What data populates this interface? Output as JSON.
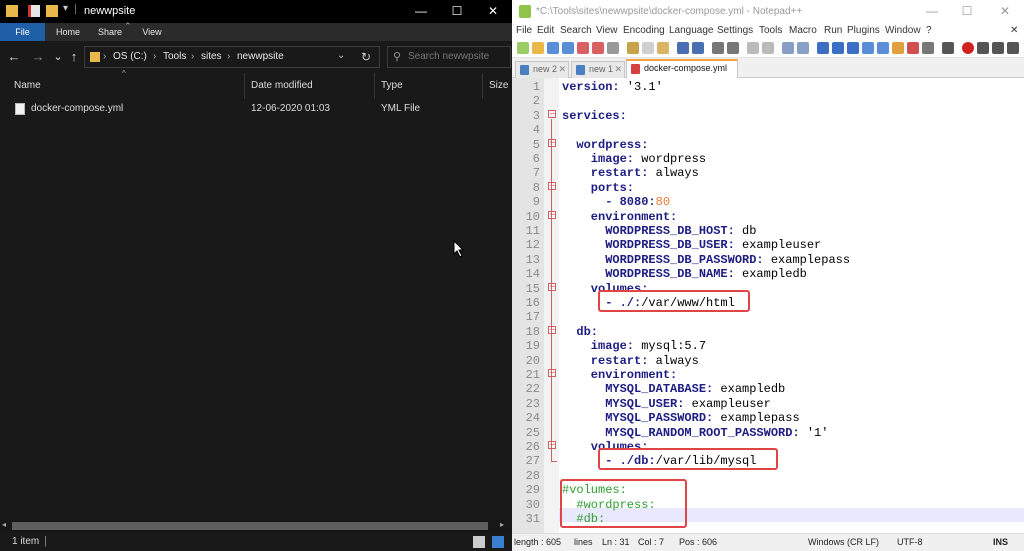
{
  "explorer": {
    "title": "newwpsite",
    "window_controls": {
      "min": "—",
      "max": "☐",
      "close": "✕"
    },
    "ribbon_tabs": [
      "File",
      "Home",
      "Share",
      "View"
    ],
    "nav": {
      "back": "←",
      "forward": "→",
      "recent": "⌄",
      "up": "↑",
      "refresh": "↻"
    },
    "breadcrumbs": [
      "OS (C:)",
      "Tools",
      "sites",
      "newwpsite"
    ],
    "search_placeholder": "Search newwpsite",
    "columns": [
      "Name",
      "Date modified",
      "Type",
      "Size"
    ],
    "files": [
      {
        "name": "docker-compose.yml",
        "date": "12-06-2020 01:03",
        "type": "YML File",
        "size": ""
      }
    ],
    "status": "1 item"
  },
  "notepad": {
    "title": "*C:\\Tools\\sites\\newwpsite\\docker-compose.yml - Notepad++",
    "window_controls": {
      "min": "—",
      "max": "☐",
      "close": "✕"
    },
    "menu": [
      "File",
      "Edit",
      "Search",
      "View",
      "Encoding",
      "Language",
      "Settings",
      "Tools",
      "Macro",
      "Run",
      "Plugins",
      "Window",
      "?"
    ],
    "tabs": [
      {
        "label": "new 2"
      },
      {
        "label": "new 1"
      },
      {
        "label": "docker-compose.yml",
        "active": true
      }
    ],
    "tab_close": "✕",
    "lines": [
      {
        "n": "1",
        "key": "version:",
        "val": " '3.1'"
      },
      {
        "n": "2",
        "key": "",
        "val": ""
      },
      {
        "n": "3",
        "key": "services:",
        "val": ""
      },
      {
        "n": "4",
        "key": "",
        "val": ""
      },
      {
        "n": "5",
        "key": "  wordpress:",
        "val": ""
      },
      {
        "n": "6",
        "key": "    image:",
        "val": " wordpress"
      },
      {
        "n": "7",
        "key": "    restart:",
        "val": " always"
      },
      {
        "n": "8",
        "key": "    ports:",
        "val": ""
      },
      {
        "n": "9",
        "key": "      - 8080:",
        "val": "80",
        "num": true
      },
      {
        "n": "10",
        "key": "    environment:",
        "val": ""
      },
      {
        "n": "11",
        "key": "      WORDPRESS_DB_HOST:",
        "val": " db"
      },
      {
        "n": "12",
        "key": "      WORDPRESS_DB_USER:",
        "val": " exampleuser"
      },
      {
        "n": "13",
        "key": "      WORDPRESS_DB_PASSWORD:",
        "val": " examplepass"
      },
      {
        "n": "14",
        "key": "      WORDPRESS_DB_NAME:",
        "val": " exampledb"
      },
      {
        "n": "15",
        "key": "    volumes:",
        "val": ""
      },
      {
        "n": "16",
        "key": "      - ./:",
        "val": "/var/www/html"
      },
      {
        "n": "17",
        "key": "",
        "val": ""
      },
      {
        "n": "18",
        "key": "  db:",
        "val": ""
      },
      {
        "n": "19",
        "key": "    image:",
        "val": " mysql:5.7"
      },
      {
        "n": "20",
        "key": "    restart:",
        "val": " always"
      },
      {
        "n": "21",
        "key": "    environment:",
        "val": ""
      },
      {
        "n": "22",
        "key": "      MYSQL_DATABASE:",
        "val": " exampledb"
      },
      {
        "n": "23",
        "key": "      MYSQL_USER:",
        "val": " exampleuser"
      },
      {
        "n": "24",
        "key": "      MYSQL_PASSWORD:",
        "val": " examplepass"
      },
      {
        "n": "25",
        "key": "      MYSQL_RANDOM_ROOT_PASSWORD:",
        "val": " '1'"
      },
      {
        "n": "26",
        "key": "    volumes:",
        "val": ""
      },
      {
        "n": "27",
        "key": "      - ./db:",
        "val": "/var/lib/mysql"
      },
      {
        "n": "28",
        "key": "",
        "val": ""
      },
      {
        "n": "29",
        "comment": "#volumes:"
      },
      {
        "n": "30",
        "comment": "  #wordpress:"
      },
      {
        "n": "31",
        "comment": "  #db:"
      }
    ],
    "status": {
      "length": "length : 605",
      "lines": "lines",
      "ln": "Ln : 31",
      "col": "Col : 7",
      "pos": "Pos : 606",
      "eol": "Windows (CR LF)",
      "encoding": "UTF-8",
      "mode": "INS"
    }
  },
  "colors": {
    "highlight_box": "#e04444",
    "explorer_bg": "#191919",
    "active_tab_accent": "#f4a43a"
  }
}
